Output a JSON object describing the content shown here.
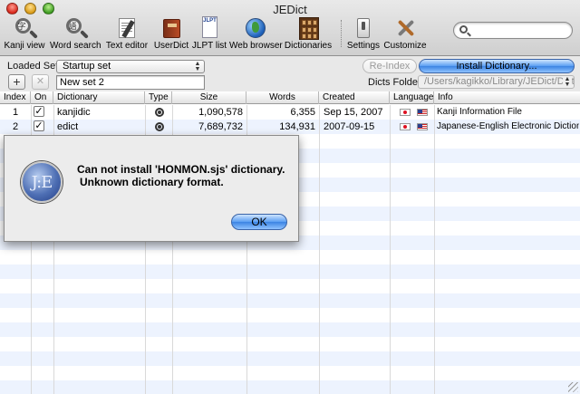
{
  "window": {
    "title": "JEDict"
  },
  "toolbar": {
    "items": [
      {
        "label": "Kanji view",
        "icon": "kanji-view-icon"
      },
      {
        "label": "Word search",
        "icon": "word-search-icon"
      },
      {
        "label": "Text editor",
        "icon": "text-editor-icon"
      },
      {
        "label": "UserDict",
        "icon": "user-dict-icon"
      },
      {
        "label": "JLPT list",
        "icon": "jlpt-list-icon"
      },
      {
        "label": "Web browser",
        "icon": "web-browser-icon"
      },
      {
        "label": "Dictionaries",
        "icon": "dictionaries-icon"
      },
      {
        "label": "Settings",
        "icon": "settings-icon"
      },
      {
        "label": "Customize",
        "icon": "customize-icon"
      }
    ],
    "jlpt_icon_text": "JLPT",
    "search": {
      "value": "",
      "placeholder": ""
    }
  },
  "controls": {
    "loaded_set_label": "Loaded Set",
    "loaded_set_value": "Startup set",
    "reindex_label": "Re-Index",
    "install_label": "Install Dictionary...",
    "add_symbol": "+",
    "remove_symbol": "✕",
    "set_name_value": "New set 2",
    "dicts_folder_label": "Dicts Folder",
    "dicts_folder_value": "/Users/kagikko/Library/JEDict/Dict"
  },
  "table": {
    "columns": [
      "Index",
      "On",
      "Dictionary",
      "Type",
      "Size",
      "Words",
      "Created",
      "Language",
      "Info"
    ],
    "rows": [
      {
        "index": "1",
        "on": true,
        "dictionary": "kanjidic",
        "size": "1,090,578",
        "words": "6,355",
        "created": "Sep 15, 2007",
        "info": "Kanji Information File"
      },
      {
        "index": "2",
        "on": true,
        "dictionary": "edict",
        "size": "7,689,732",
        "words": "134,931",
        "created": "2007-09-15",
        "info": "Japanese-English Electronic Dictionary"
      }
    ]
  },
  "alert": {
    "logo_text": "J:E",
    "line1": "Can not install 'HONMON.sjs' dictionary.",
    "line2": "Unknown dictionary format.",
    "ok_label": "OK"
  },
  "colors": {
    "aqua_blue": "#5a9ef2",
    "row_stripe": "#edf3fe"
  }
}
